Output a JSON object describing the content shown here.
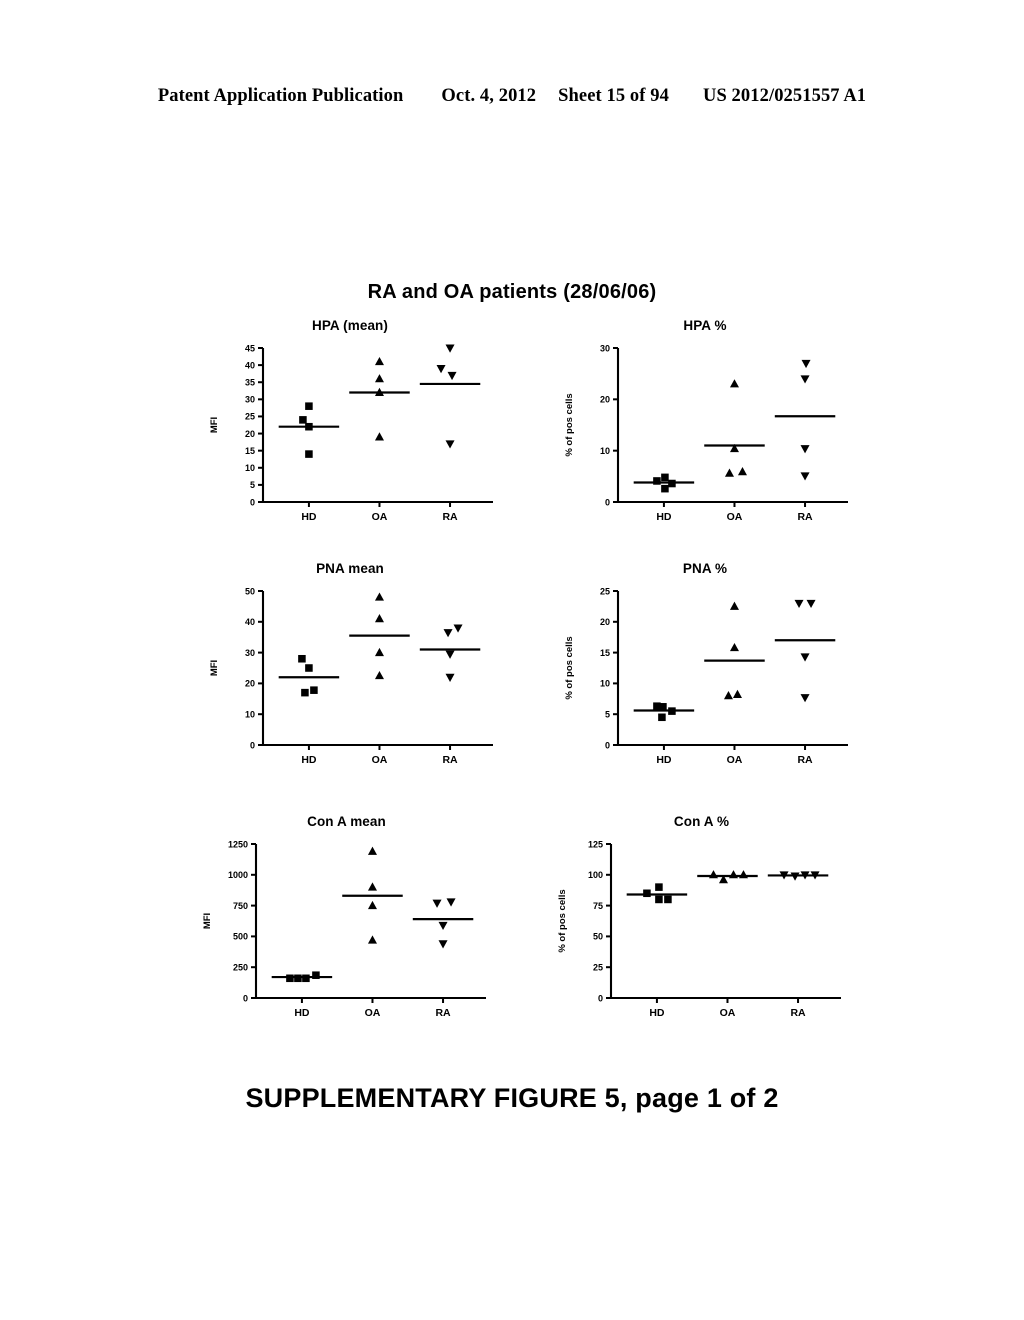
{
  "header": {
    "publication": "Patent Application Publication",
    "date": "Oct. 4, 2012",
    "sheet": "Sheet 15 of 94",
    "number": "US 2012/0251557 A1"
  },
  "figure": {
    "title": "RA and OA patients (28/06/06)",
    "caption": "SUPPLEMENTARY FIGURE 5, page 1 of 2"
  },
  "groups": {
    "hd": "HD",
    "oa": "OA",
    "ra": "RA"
  },
  "axis_labels": {
    "mfi": "MFI",
    "pos_cells": "% of pos cells"
  },
  "chart_data": [
    {
      "id": "hpa-mean",
      "type": "scatter",
      "title": "HPA (mean)",
      "xlabel": "",
      "ylabel": "MFI",
      "ylim": [
        0,
        45
      ],
      "yticks": [
        0,
        5,
        10,
        15,
        20,
        25,
        30,
        35,
        40,
        45
      ],
      "ytick_labels": [
        "0",
        "5",
        "10",
        "15",
        "20",
        "25",
        "30",
        "35",
        "40",
        "45"
      ],
      "categories": [
        "HD",
        "OA",
        "RA"
      ],
      "grid": false,
      "legend": "none",
      "series": [
        {
          "name": "HD",
          "marker": "square",
          "values": [
            28,
            24,
            22,
            14
          ],
          "jitter": [
            0,
            -6,
            0,
            0
          ],
          "mean": 22
        },
        {
          "name": "OA",
          "marker": "triangle-up",
          "values": [
            41,
            36,
            32,
            19
          ],
          "jitter": [
            0,
            0,
            0,
            0
          ],
          "mean": 32
        },
        {
          "name": "RA",
          "marker": "triangle-down",
          "values": [
            45,
            39,
            37,
            17
          ],
          "jitter": [
            0,
            -9,
            2,
            0
          ],
          "mean": 34.5
        }
      ]
    },
    {
      "id": "hpa-pct",
      "type": "scatter",
      "title": "HPA %",
      "xlabel": "",
      "ylabel": "% of pos cells",
      "ylim": [
        0,
        30
      ],
      "yticks": [
        0,
        10,
        20,
        30
      ],
      "ytick_labels": [
        "0",
        "10",
        "20",
        "30"
      ],
      "categories": [
        "HD",
        "OA",
        "RA"
      ],
      "grid": false,
      "legend": "none",
      "series": [
        {
          "name": "HD",
          "marker": "square",
          "values": [
            4.8,
            4.1,
            3.6,
            2.6
          ],
          "jitter": [
            1,
            -7,
            8,
            1
          ],
          "mean": 3.8
        },
        {
          "name": "OA",
          "marker": "triangle-up",
          "values": [
            23,
            10.4,
            5.6,
            5.9
          ],
          "jitter": [
            0,
            0,
            -5,
            8
          ],
          "mean": 11
        },
        {
          "name": "RA",
          "marker": "triangle-down",
          "values": [
            27,
            24,
            10.4,
            5.1
          ],
          "jitter": [
            1,
            0,
            0,
            0
          ],
          "mean": 16.7
        }
      ]
    },
    {
      "id": "pna-mean",
      "type": "scatter",
      "title": "PNA mean",
      "xlabel": "",
      "ylabel": "MFI",
      "ylim": [
        0,
        50
      ],
      "yticks": [
        0,
        10,
        20,
        30,
        40,
        50
      ],
      "ytick_labels": [
        "0",
        "10",
        "20",
        "30",
        "40",
        "50"
      ],
      "categories": [
        "HD",
        "OA",
        "RA"
      ],
      "grid": false,
      "legend": "none",
      "series": [
        {
          "name": "HD",
          "marker": "square",
          "values": [
            28,
            25,
            17.8,
            17
          ],
          "jitter": [
            -7,
            0,
            5,
            -4
          ],
          "mean": 22
        },
        {
          "name": "OA",
          "marker": "triangle-up",
          "values": [
            48,
            41,
            30,
            22.5
          ],
          "jitter": [
            0,
            0,
            0,
            0
          ],
          "mean": 35.5
        },
        {
          "name": "RA",
          "marker": "triangle-down",
          "values": [
            38,
            36.5,
            29.5,
            22
          ],
          "jitter": [
            8,
            -2,
            0,
            0
          ],
          "mean": 31
        }
      ]
    },
    {
      "id": "pna-pct",
      "type": "scatter",
      "title": "PNA %",
      "xlabel": "",
      "ylabel": "% of pos cells",
      "ylim": [
        0,
        25
      ],
      "yticks": [
        0,
        5,
        10,
        15,
        20,
        25
      ],
      "ytick_labels": [
        "0",
        "5",
        "10",
        "15",
        "20",
        "25"
      ],
      "categories": [
        "HD",
        "OA",
        "RA"
      ],
      "grid": false,
      "legend": "none",
      "series": [
        {
          "name": "HD",
          "marker": "square",
          "values": [
            6.3,
            6.2,
            5.5,
            4.5
          ],
          "jitter": [
            -7,
            -1,
            8,
            -2
          ],
          "mean": 5.6
        },
        {
          "name": "OA",
          "marker": "triangle-up",
          "values": [
            22.5,
            15.8,
            8.0,
            8.2
          ],
          "jitter": [
            0,
            0,
            -6,
            3
          ],
          "mean": 13.7
        },
        {
          "name": "RA",
          "marker": "triangle-down",
          "values": [
            23,
            23,
            14.3,
            7.7
          ],
          "jitter": [
            -6,
            6,
            0,
            0
          ],
          "mean": 17
        }
      ]
    },
    {
      "id": "cona-mean",
      "type": "scatter",
      "title": "Con A mean",
      "xlabel": "",
      "ylabel": "MFI",
      "ylim": [
        0,
        1250
      ],
      "yticks": [
        0,
        250,
        500,
        750,
        1000,
        1250
      ],
      "ytick_labels": [
        "0",
        "250",
        "500",
        "750",
        "1000",
        "1250"
      ],
      "categories": [
        "HD",
        "OA",
        "RA"
      ],
      "grid": false,
      "legend": "none",
      "series": [
        {
          "name": "HD",
          "marker": "square",
          "values": [
            160,
            160,
            160,
            185
          ],
          "jitter": [
            -12,
            -4,
            4,
            14
          ],
          "mean": 170
        },
        {
          "name": "OA",
          "marker": "triangle-up",
          "values": [
            1190,
            900,
            750,
            470
          ],
          "jitter": [
            0,
            0,
            0,
            0
          ],
          "mean": 830
        },
        {
          "name": "RA",
          "marker": "triangle-down",
          "values": [
            770,
            780,
            590,
            440
          ],
          "jitter": [
            -6,
            8,
            0,
            0
          ],
          "mean": 640
        }
      ]
    },
    {
      "id": "cona-pct",
      "type": "scatter",
      "title": "Con A %",
      "xlabel": "",
      "ylabel": "% of pos cells",
      "ylim": [
        0,
        125
      ],
      "yticks": [
        0,
        25,
        50,
        75,
        100,
        125
      ],
      "ytick_labels": [
        "0",
        "25",
        "50",
        "75",
        "100",
        "125"
      ],
      "categories": [
        "HD",
        "OA",
        "RA"
      ],
      "grid": false,
      "legend": "none",
      "series": [
        {
          "name": "HD",
          "marker": "square",
          "values": [
            90,
            85,
            80,
            80
          ],
          "jitter": [
            2,
            -10,
            2,
            11
          ],
          "mean": 84
        },
        {
          "name": "OA",
          "marker": "triangle-up",
          "values": [
            100,
            96,
            100,
            100
          ],
          "jitter": [
            -14,
            -4,
            6,
            16
          ],
          "mean": 99
        },
        {
          "name": "RA",
          "marker": "triangle-down",
          "values": [
            100,
            99,
            100,
            100
          ],
          "jitter": [
            -14,
            -3,
            7,
            17
          ],
          "mean": 99.5
        }
      ]
    }
  ]
}
